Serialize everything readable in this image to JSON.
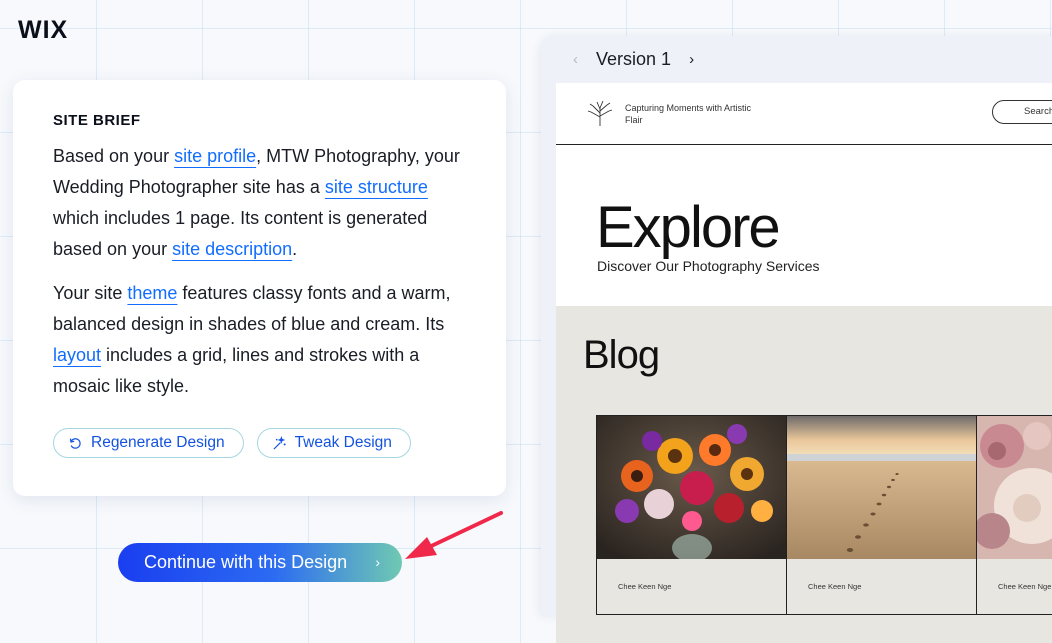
{
  "brand": {
    "logo": "WIX"
  },
  "brief": {
    "title": "SITE BRIEF",
    "p1": {
      "t1": "Based on your ",
      "link_profile": "site profile",
      "t2": ", MTW Photography, your Wedding Photographer site has a ",
      "link_structure": "site structure",
      "t3": " which includes 1 page. Its content is generated based on your ",
      "link_description": "site description",
      "t4": "."
    },
    "p2": {
      "t1": "Your site ",
      "link_theme": "theme",
      "t2": " features classy fonts and a warm, balanced design in shades of blue and cream. Its ",
      "link_layout": "layout",
      "t3": " includes a grid, lines and strokes with a mosaic like style."
    },
    "regenerate_label": "Regenerate Design",
    "tweak_label": "Tweak Design"
  },
  "continue_label": "Continue with this Design",
  "preview": {
    "version_label": "Version 1",
    "site": {
      "tagline": "Capturing Moments with Artistic Flair",
      "search_label": "Search",
      "hero_title": "Explore",
      "hero_subtitle": "Discover Our Photography Services",
      "blog_title": "Blog",
      "posts": [
        {
          "author": "Chee Keen Nge",
          "image": "flower-bouquet"
        },
        {
          "author": "Chee Keen Nge",
          "image": "beach-footprints"
        },
        {
          "author": "Chee Keen Nge",
          "image": "pink-roses"
        }
      ]
    }
  },
  "colors": {
    "accent": "#116dff",
    "button_gradient_start": "#1a3ef0",
    "button_gradient_end": "#6fc9b2",
    "annotation_arrow": "#f0284a"
  },
  "icons": {
    "regenerate": "refresh-icon",
    "tweak": "magic-wand-icon",
    "continue": "chevron-right-icon",
    "version_prev": "chevron-left-icon",
    "version_next": "chevron-right-icon",
    "site_logo": "tree-icon"
  }
}
